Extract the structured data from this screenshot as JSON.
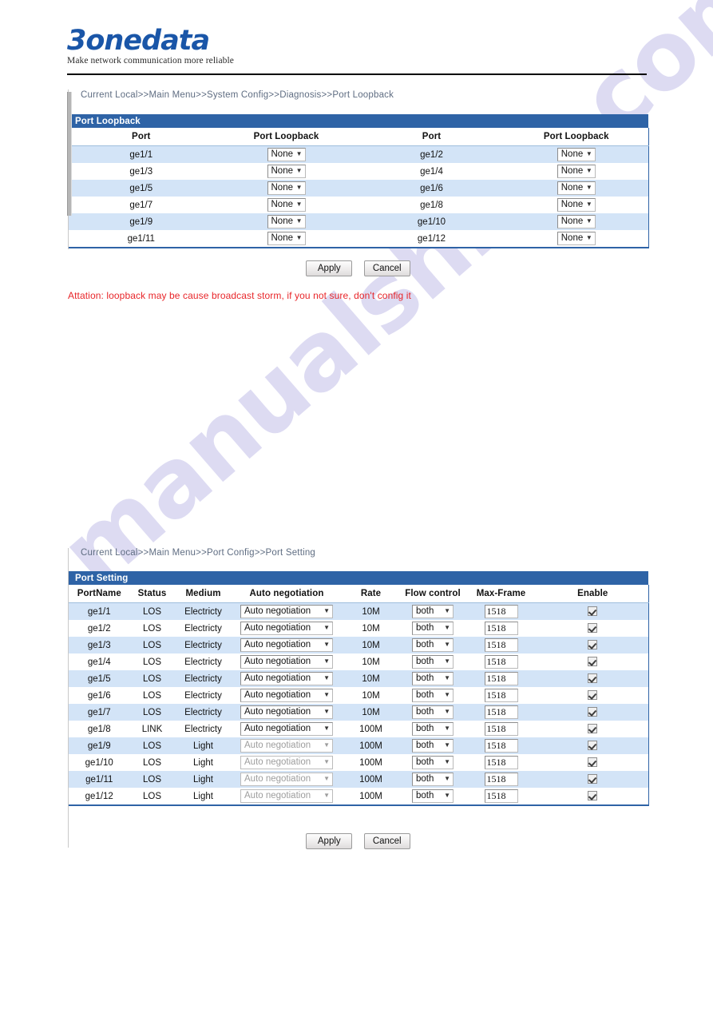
{
  "brand": {
    "logo_text": "3onedata",
    "tagline": "Make network communication more reliable"
  },
  "watermark": {
    "text": "manualshive.com"
  },
  "colors": {
    "panel_header_bg": "#2e63a6",
    "row_alt_bg": "#d3e4f7",
    "notice_red": "#e8262a",
    "logo_blue": "#1a56a8"
  },
  "loopback": {
    "breadcrumb": "Current Local>>Main Menu>>System Config>>Diagnosis>>Port Loopback",
    "panel_title": "Port Loopback",
    "columns": [
      "Port",
      "Port Loopback",
      "Port",
      "Port Loopback"
    ],
    "rows": [
      {
        "port_a": "ge1/1",
        "loopback_a": "None",
        "port_b": "ge1/2",
        "loopback_b": "None"
      },
      {
        "port_a": "ge1/3",
        "loopback_a": "None",
        "port_b": "ge1/4",
        "loopback_b": "None"
      },
      {
        "port_a": "ge1/5",
        "loopback_a": "None",
        "port_b": "ge1/6",
        "loopback_b": "None"
      },
      {
        "port_a": "ge1/7",
        "loopback_a": "None",
        "port_b": "ge1/8",
        "loopback_b": "None"
      },
      {
        "port_a": "ge1/9",
        "loopback_a": "None",
        "port_b": "ge1/10",
        "loopback_b": "None"
      },
      {
        "port_a": "ge1/11",
        "loopback_a": "None",
        "port_b": "ge1/12",
        "loopback_b": "None"
      }
    ],
    "apply_label": "Apply",
    "cancel_label": "Cancel",
    "notice": "Attation:  loopback may be cause broadcast storm, if you not sure, don't config it"
  },
  "portsetting": {
    "breadcrumb": "Current Local>>Main Menu>>Port Config>>Port Setting",
    "panel_title": "Port Setting",
    "columns": [
      "PortName",
      "Status",
      "Medium",
      "Auto negotiation",
      "Rate",
      "Flow control",
      "Max-Frame",
      "Enable"
    ],
    "rows": [
      {
        "port": "ge1/1",
        "status": "LOS",
        "medium": "Electricty",
        "auto": "Auto negotiation",
        "auto_disabled": false,
        "rate": "10M",
        "flow": "both",
        "maxframe": "1518",
        "enable": true
      },
      {
        "port": "ge1/2",
        "status": "LOS",
        "medium": "Electricty",
        "auto": "Auto negotiation",
        "auto_disabled": false,
        "rate": "10M",
        "flow": "both",
        "maxframe": "1518",
        "enable": true
      },
      {
        "port": "ge1/3",
        "status": "LOS",
        "medium": "Electricty",
        "auto": "Auto negotiation",
        "auto_disabled": false,
        "rate": "10M",
        "flow": "both",
        "maxframe": "1518",
        "enable": true
      },
      {
        "port": "ge1/4",
        "status": "LOS",
        "medium": "Electricty",
        "auto": "Auto negotiation",
        "auto_disabled": false,
        "rate": "10M",
        "flow": "both",
        "maxframe": "1518",
        "enable": true
      },
      {
        "port": "ge1/5",
        "status": "LOS",
        "medium": "Electricty",
        "auto": "Auto negotiation",
        "auto_disabled": false,
        "rate": "10M",
        "flow": "both",
        "maxframe": "1518",
        "enable": true
      },
      {
        "port": "ge1/6",
        "status": "LOS",
        "medium": "Electricty",
        "auto": "Auto negotiation",
        "auto_disabled": false,
        "rate": "10M",
        "flow": "both",
        "maxframe": "1518",
        "enable": true
      },
      {
        "port": "ge1/7",
        "status": "LOS",
        "medium": "Electricty",
        "auto": "Auto negotiation",
        "auto_disabled": false,
        "rate": "10M",
        "flow": "both",
        "maxframe": "1518",
        "enable": true
      },
      {
        "port": "ge1/8",
        "status": "LINK",
        "medium": "Electricty",
        "auto": "Auto negotiation",
        "auto_disabled": false,
        "rate": "100M",
        "flow": "both",
        "maxframe": "1518",
        "enable": true
      },
      {
        "port": "ge1/9",
        "status": "LOS",
        "medium": "Light",
        "auto": "Auto negotiation",
        "auto_disabled": true,
        "rate": "100M",
        "flow": "both",
        "maxframe": "1518",
        "enable": true
      },
      {
        "port": "ge1/10",
        "status": "LOS",
        "medium": "Light",
        "auto": "Auto negotiation",
        "auto_disabled": true,
        "rate": "100M",
        "flow": "both",
        "maxframe": "1518",
        "enable": true
      },
      {
        "port": "ge1/11",
        "status": "LOS",
        "medium": "Light",
        "auto": "Auto negotiation",
        "auto_disabled": true,
        "rate": "100M",
        "flow": "both",
        "maxframe": "1518",
        "enable": true
      },
      {
        "port": "ge1/12",
        "status": "LOS",
        "medium": "Light",
        "auto": "Auto negotiation",
        "auto_disabled": true,
        "rate": "100M",
        "flow": "both",
        "maxframe": "1518",
        "enable": true
      }
    ],
    "apply_label": "Apply",
    "cancel_label": "Cancel"
  }
}
